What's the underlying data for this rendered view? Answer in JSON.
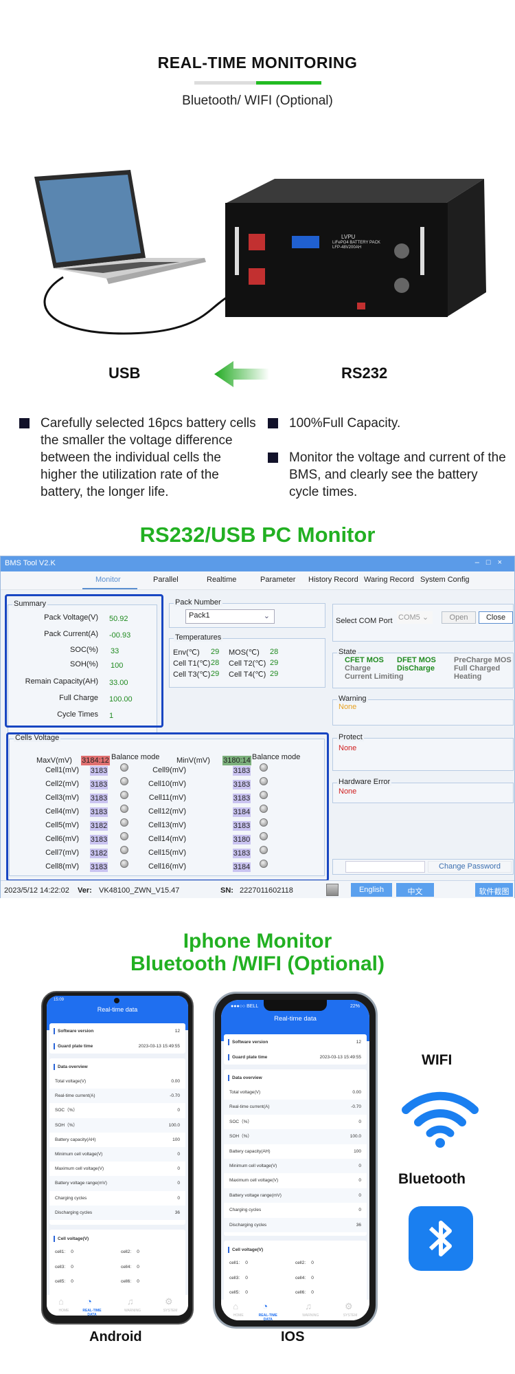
{
  "header": {
    "title": "REAL-TIME MONITORING",
    "subtitle": "Bluetooth/ WIFI (Optional)",
    "accent": "#22bb22"
  },
  "hero": {
    "left_label": "USB",
    "right_label": "RS232",
    "battery_brand": "LVPU",
    "battery_model": "LiFePO4 BATTERY PACK LFP-48V200AH"
  },
  "bullets": [
    "Carefully selected 16pcs battery cells the smaller the voltage difference between the individual cells the higher the utilization rate of the battery, the longer life.",
    "100%Full Capacity.",
    "Monitor the voltage and current of the BMS, and clearly see the battery cycle times."
  ],
  "pc_section_title": "RS232/USB PC Monitor",
  "bms": {
    "window_title": "BMS Tool V2.K",
    "tabs": [
      "Monitor",
      "Parallel",
      "Realtime",
      "Parameter",
      "History Record",
      "Waring Record",
      "System Config"
    ],
    "summary": {
      "title": "Summary",
      "rows": [
        {
          "label": "Pack Voltage(V)",
          "value": "50.92"
        },
        {
          "label": "Pack Current(A)",
          "value": "-00.93"
        },
        {
          "label": "SOC(%)",
          "value": "33"
        },
        {
          "label": "SOH(%)",
          "value": "100"
        },
        {
          "label": "Remain Capacity(AH)",
          "value": "33.00"
        },
        {
          "label": "Full Charge",
          "value": "100.00"
        },
        {
          "label": "Cycle Times",
          "value": "1"
        }
      ]
    },
    "pack_number": {
      "title": "Pack Number",
      "value": "Pack1"
    },
    "temperatures": {
      "title": "Temperatures",
      "items": [
        {
          "label": "Env(℃)",
          "value": "29"
        },
        {
          "label": "MOS(℃)",
          "value": "28"
        },
        {
          "label": "Cell T1(℃)",
          "value": "28"
        },
        {
          "label": "Cell T2(℃)",
          "value": "29"
        },
        {
          "label": "Cell T3(℃)",
          "value": "29"
        },
        {
          "label": "Cell T4(℃)",
          "value": "29"
        }
      ]
    },
    "com": {
      "label": "Select COM Port",
      "value": "COM5",
      "open": "Open",
      "close": "Close"
    },
    "state": {
      "title": "State",
      "items": [
        {
          "text": "CFET MOS",
          "on": true
        },
        {
          "text": "DFET MOS",
          "on": true
        },
        {
          "text": "PreCharge MOS",
          "on": false
        },
        {
          "text": "Charge",
          "on": false
        },
        {
          "text": "DisCharge",
          "on": true
        },
        {
          "text": "Full Charged",
          "on": false
        },
        {
          "text": "Current Limiting",
          "on": false
        },
        {
          "text": "",
          "on": false
        },
        {
          "text": "Heating",
          "on": false
        }
      ]
    },
    "warning": {
      "title": "Warning",
      "value": "None"
    },
    "protect": {
      "title": "Protect",
      "value": "None"
    },
    "hardware_error": {
      "title": "Hardware Error",
      "value": "None"
    },
    "cells": {
      "title": "Cells Voltage",
      "maxv_label": "MaxV(mV)",
      "maxv": "3184:12",
      "minv_label": "MinV(mV)",
      "minv": "3180:14",
      "balance_label": "Balance mode",
      "values": [
        {
          "label": "Cell1(mV)",
          "value": "3183"
        },
        {
          "label": "Cell2(mV)",
          "value": "3183"
        },
        {
          "label": "Cell3(mV)",
          "value": "3183"
        },
        {
          "label": "Cell4(mV)",
          "value": "3183"
        },
        {
          "label": "Cell5(mV)",
          "value": "3182"
        },
        {
          "label": "Cell6(mV)",
          "value": "3183"
        },
        {
          "label": "Cell7(mV)",
          "value": "3182"
        },
        {
          "label": "Cell8(mV)",
          "value": "3183"
        },
        {
          "label": "Cell9(mV)",
          "value": "3183"
        },
        {
          "label": "Cell10(mV)",
          "value": "3183"
        },
        {
          "label": "Cell11(mV)",
          "value": "3183"
        },
        {
          "label": "Cell12(mV)",
          "value": "3184"
        },
        {
          "label": "Cell13(mV)",
          "value": "3183"
        },
        {
          "label": "Cell14(mV)",
          "value": "3180"
        },
        {
          "label": "Cell15(mV)",
          "value": "3183"
        },
        {
          "label": "Cell16(mV)",
          "value": "3184"
        }
      ]
    },
    "password": {
      "value": "",
      "button": "Change Password"
    },
    "status": {
      "datetime": "2023/5/12 14:22:02",
      "ver_label": "Ver:",
      "ver": "VK48100_ZWN_V15.47",
      "sn_label": "SN:",
      "sn": "2227011602118",
      "english": "English",
      "chinese": "中文",
      "screenshot": "软件截图"
    }
  },
  "phone_section": {
    "line1": "Iphone Monitor",
    "line2": "Bluetooth /WIFI (Optional)"
  },
  "phones": {
    "android": {
      "label": "Android",
      "status_left": "15:09",
      "status_right": "",
      "title": "Real-time data"
    },
    "ios": {
      "label": "IOS",
      "status_left": "●●●○○ BELL",
      "status_right": "22%",
      "title": "Real-time data"
    },
    "info": [
      {
        "label": "Software version",
        "value": "12"
      },
      {
        "label": "Guard plate time",
        "value": "2023-03-13 15:49:55"
      }
    ],
    "overview_title": "Data overview",
    "overview": [
      {
        "label": "Total voltage(V)",
        "value": "0.00"
      },
      {
        "label": "Real-time current(A)",
        "value": "-0.70"
      },
      {
        "label": "SOC（%）",
        "value": "0"
      },
      {
        "label": "SOH（%）",
        "value": "100.0"
      },
      {
        "label": "Battery capacity(AH)",
        "value": "100"
      },
      {
        "label": "Minimum cell voltage(V)",
        "value": "0"
      },
      {
        "label": "Maximum cell voltage(V)",
        "value": "0"
      },
      {
        "label": "Battery voltage range(mV)",
        "value": "0"
      },
      {
        "label": "Charging cycles",
        "value": "0"
      },
      {
        "label": "Discharging cycles",
        "value": "36"
      }
    ],
    "cell_title": "Cell voltage(V)",
    "cells": [
      {
        "label": "cell1:",
        "value": "0"
      },
      {
        "label": "cell2:",
        "value": "0"
      },
      {
        "label": "cell3:",
        "value": "0"
      },
      {
        "label": "cell4:",
        "value": "0"
      },
      {
        "label": "cell5:",
        "value": "0"
      },
      {
        "label": "cell6:",
        "value": "0"
      }
    ],
    "tabs": [
      "HOME",
      "REAL-TIME DATA",
      "WARNING",
      "SYSTEM"
    ]
  },
  "connectivity": {
    "wifi": "WIFI",
    "bluetooth": "Bluetooth",
    "icon_color": "#1a7ff0"
  }
}
